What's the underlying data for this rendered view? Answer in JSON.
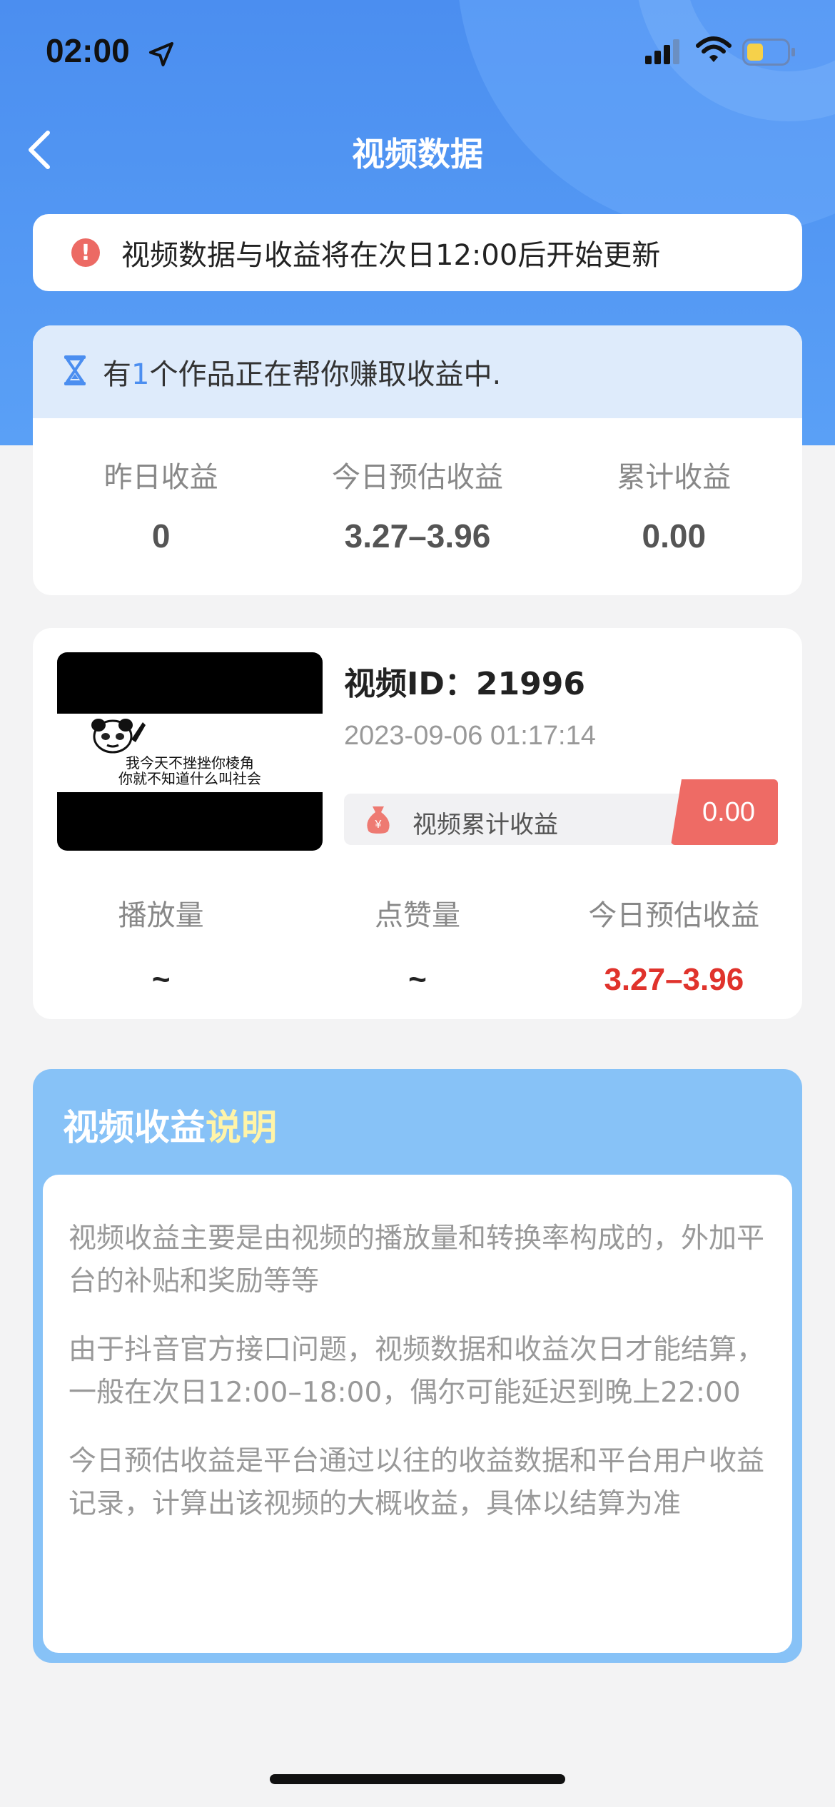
{
  "status_bar": {
    "time": "02:00"
  },
  "nav": {
    "title": "视频数据"
  },
  "notice": {
    "text": "视频数据与收益将在次日12:00后开始更新"
  },
  "summary": {
    "head_prefix": "有",
    "head_count": "1",
    "head_suffix": "个作品正在帮你赚取收益中.",
    "cols": [
      {
        "label": "昨日收益",
        "value": "0"
      },
      {
        "label": "今日预估收益",
        "value": "3.27–3.96"
      },
      {
        "label": "累计收益",
        "value": "0.00"
      }
    ]
  },
  "video": {
    "thumb_caption_1": "我今天不挫挫你棱角",
    "thumb_caption_2": "你就不知道什么叫社会",
    "id": "视频ID：21996",
    "date": "2023-09-06 01:17:14",
    "earn_label": "视频累计收益",
    "earn_value": "0.00",
    "stats": [
      {
        "label": "播放量",
        "value": "~"
      },
      {
        "label": "点赞量",
        "value": "~"
      },
      {
        "label": "今日预估收益",
        "value": "3.27–3.96"
      }
    ]
  },
  "explain": {
    "title_main": "视频收益",
    "title_hl": "说明",
    "paragraphs": [
      "视频收益主要是由视频的播放量和转换率构成的，外加平台的补贴和奖励等等",
      "由于抖音官方接口问题，视频数据和收益次日才能结算，一般在次日12:00–18:00，偶尔可能延迟到晚上22:00",
      "今日预估收益是平台通过以往的收益数据和平台用户收益记录，计算出该视频的大概收益，具体以结算为准"
    ]
  },
  "colors": {
    "primary": "#4b8ef0",
    "alert": "#ec6a64",
    "earn_badge": "#ee6b65",
    "highlight_value": "#e0332c",
    "explain_bg": "#87c2f7",
    "title_highlight": "#fff4a8"
  },
  "icons": [
    "location-arrow-icon",
    "cellular-signal-icon",
    "wifi-icon",
    "battery-icon",
    "back-chevron-icon",
    "alert-icon",
    "hourglass-icon",
    "moneybag-icon"
  ]
}
